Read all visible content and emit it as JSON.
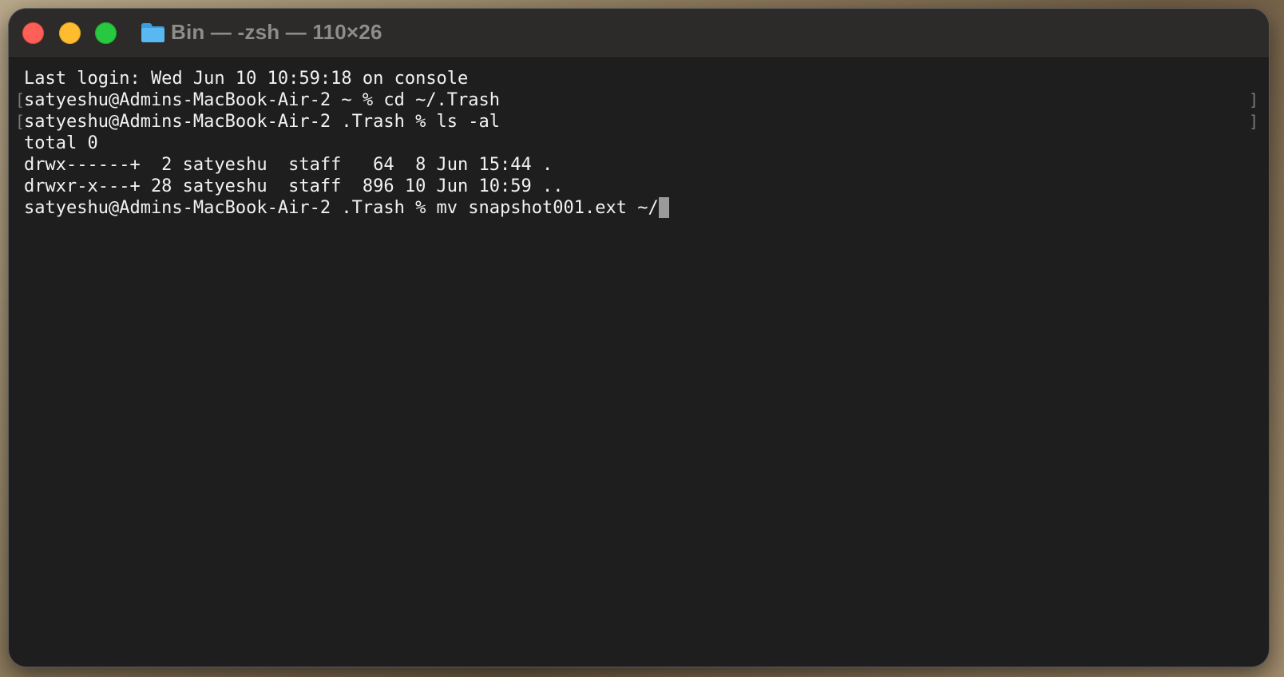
{
  "window": {
    "title": "Bin — -zsh — 110×26"
  },
  "terminal": {
    "lines": [
      "Last login: Wed Jun 10 10:59:18 on console",
      "satyeshu@Admins-MacBook-Air-2 ~ % cd ~/.Trash",
      "satyeshu@Admins-MacBook-Air-2 .Trash % ls -al",
      "total 0",
      "drwx------+  2 satyeshu  staff   64  8 Jun 15:44 .",
      "drwxr-x---+ 28 satyeshu  staff  896 10 Jun 10:59 ..",
      "satyeshu@Admins-MacBook-Air-2 .Trash % mv snapshot001.ext ~/"
    ],
    "bracket_left": "[",
    "bracket_right": "]"
  },
  "icons": {
    "close": "close-light-icon",
    "minimize": "minimize-light-icon",
    "zoom": "zoom-light-icon",
    "folder": "folder-icon"
  },
  "colors": {
    "close": "#fe5f57",
    "minimize": "#febc2e",
    "zoom": "#28c840",
    "folder": "#5ab8f0",
    "background": "#1e1e1e",
    "text": "#f2f2f2"
  }
}
